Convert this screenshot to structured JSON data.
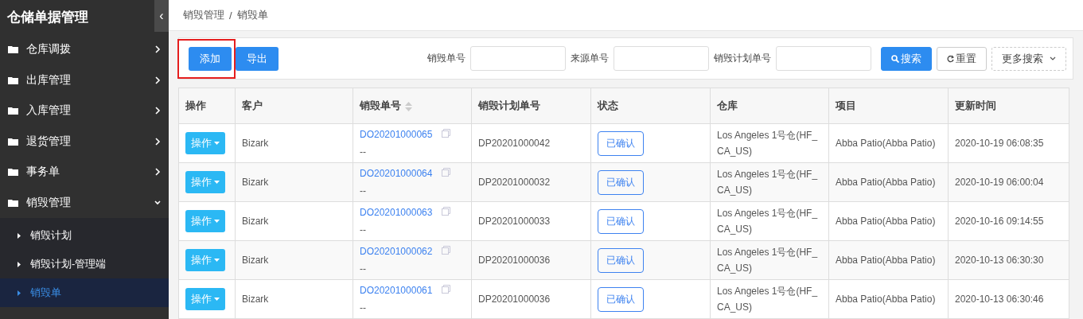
{
  "sidebar": {
    "title": "仓储单据管理",
    "collapse_toggle": "‹",
    "items": [
      {
        "label": "仓库调拨",
        "expanded": false
      },
      {
        "label": "出库管理",
        "expanded": false
      },
      {
        "label": "入库管理",
        "expanded": false
      },
      {
        "label": "退货管理",
        "expanded": false
      },
      {
        "label": "事务单",
        "expanded": false
      },
      {
        "label": "销毁管理",
        "expanded": true,
        "children": [
          {
            "label": "销毁计划",
            "selected": false
          },
          {
            "label": "销毁计划-管理端",
            "selected": false
          },
          {
            "label": "销毁单",
            "selected": true
          }
        ]
      }
    ]
  },
  "breadcrumb": [
    "销毁管理",
    "销毁单"
  ],
  "breadcrumb_separator": "/",
  "toolbar": {
    "buttons": [
      {
        "label": "添加",
        "highlighted": true
      },
      {
        "label": "导出",
        "highlighted": false
      }
    ],
    "filters": [
      {
        "label": "销毁单号"
      },
      {
        "label": "来源单号"
      },
      {
        "label": "销毁计划单号"
      }
    ],
    "actions": [
      {
        "kind": "search",
        "label": "搜索"
      },
      {
        "kind": "reset",
        "label": "重置"
      },
      {
        "kind": "more",
        "label": "更多搜索"
      }
    ]
  },
  "table": {
    "columns": [
      {
        "label": "操作",
        "sortable": false
      },
      {
        "label": "客户",
        "sortable": false
      },
      {
        "label": "销毁单号",
        "sortable": true
      },
      {
        "label": "销毁计划单号",
        "sortable": false
      },
      {
        "label": "状态",
        "sortable": false
      },
      {
        "label": "仓库",
        "sortable": false
      },
      {
        "label": "项目",
        "sortable": false
      },
      {
        "label": "更新时间",
        "sortable": false
      }
    ],
    "rows": [
      {
        "action": "操作",
        "customer": "Bizark",
        "order_no": "DO20201000065",
        "order_sub": "--",
        "plan_no": "DP20201000042",
        "status": "已确认",
        "warehouse": "Los Angeles 1号仓(HF_CA_US)",
        "project": "Abba Patio(Abba Patio)",
        "updated": "2020-10-19 06:08:35"
      },
      {
        "action": "操作",
        "customer": "Bizark",
        "order_no": "DO20201000064",
        "order_sub": "--",
        "plan_no": "DP20201000032",
        "status": "已确认",
        "warehouse": "Los Angeles 1号仓(HF_CA_US)",
        "project": "Abba Patio(Abba Patio)",
        "updated": "2020-10-19 06:00:04"
      },
      {
        "action": "操作",
        "customer": "Bizark",
        "order_no": "DO20201000063",
        "order_sub": "--",
        "plan_no": "DP20201000033",
        "status": "已确认",
        "warehouse": "Los Angeles 1号仓(HF_CA_US)",
        "project": "Abba Patio(Abba Patio)",
        "updated": "2020-10-16 09:14:55"
      },
      {
        "action": "操作",
        "customer": "Bizark",
        "order_no": "DO20201000062",
        "order_sub": "--",
        "plan_no": "DP20201000036",
        "status": "已确认",
        "warehouse": "Los Angeles 1号仓(HF_CA_US)",
        "project": "Abba Patio(Abba Patio)",
        "updated": "2020-10-13 06:30:30"
      },
      {
        "action": "操作",
        "customer": "Bizark",
        "order_no": "DO20201000061",
        "order_sub": "--",
        "plan_no": "DP20201000036",
        "status": "已确认",
        "warehouse": "Los Angeles 1号仓(HF_CA_US)",
        "project": "Abba Patio(Abba Patio)",
        "updated": "2020-10-13 06:30:46"
      }
    ]
  }
}
